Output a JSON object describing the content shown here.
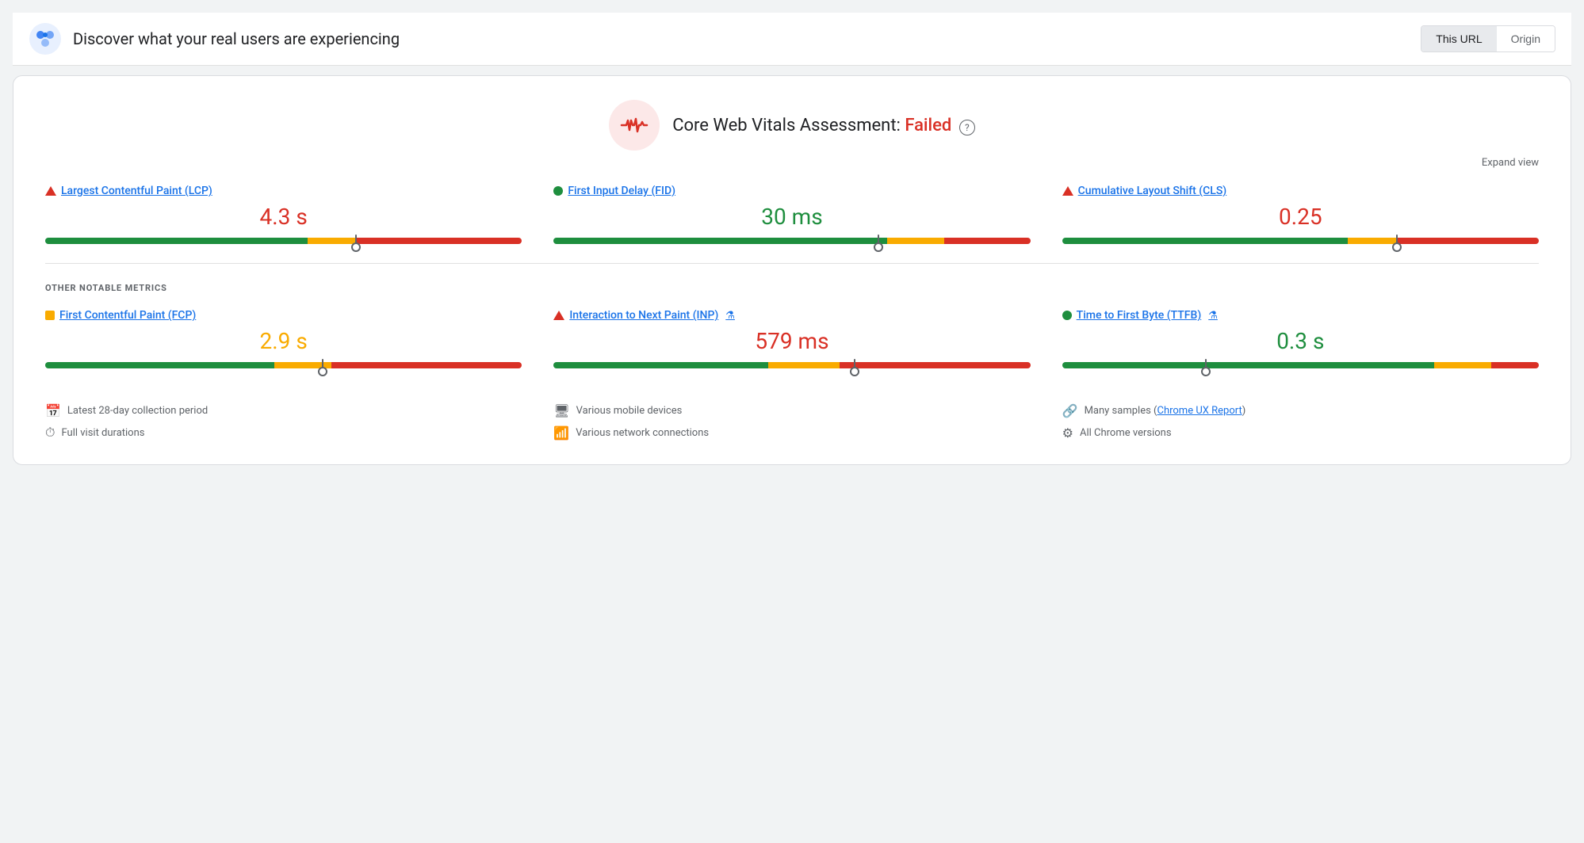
{
  "header": {
    "title": "Discover what your real users are experiencing",
    "this_url_label": "This URL",
    "origin_label": "Origin",
    "active_tab": "this_url"
  },
  "assessment": {
    "title_prefix": "Core Web Vitals Assessment: ",
    "status": "Failed",
    "expand_label": "Expand view",
    "info_label": "?"
  },
  "core_vitals": {
    "section_label": "",
    "metrics": [
      {
        "id": "lcp",
        "label": "Largest Contentful Paint (LCP)",
        "status": "red_triangle",
        "value": "4.3 s",
        "value_color": "red",
        "bar": {
          "green": 55,
          "orange": 10,
          "red": 35,
          "marker": 65
        }
      },
      {
        "id": "fid",
        "label": "First Input Delay (FID)",
        "status": "green_dot",
        "value": "30 ms",
        "value_color": "green",
        "bar": {
          "green": 70,
          "orange": 12,
          "red": 18,
          "marker": 68
        }
      },
      {
        "id": "cls",
        "label": "Cumulative Layout Shift (CLS)",
        "status": "red_triangle",
        "value": "0.25",
        "value_color": "red",
        "bar": {
          "green": 60,
          "orange": 10,
          "red": 30,
          "marker": 70
        }
      }
    ]
  },
  "other_metrics": {
    "section_label": "OTHER NOTABLE METRICS",
    "metrics": [
      {
        "id": "fcp",
        "label": "First Contentful Paint (FCP)",
        "status": "orange_square",
        "value": "2.9 s",
        "value_color": "orange",
        "has_flask": false,
        "bar": {
          "green": 48,
          "orange": 12,
          "red": 40,
          "marker": 58
        }
      },
      {
        "id": "inp",
        "label": "Interaction to Next Paint (INP)",
        "status": "red_triangle",
        "value": "579 ms",
        "value_color": "red",
        "has_flask": true,
        "bar": {
          "green": 45,
          "orange": 15,
          "red": 40,
          "marker": 63
        }
      },
      {
        "id": "ttfb",
        "label": "Time to First Byte (TTFB)",
        "status": "green_dot",
        "value": "0.3 s",
        "value_color": "green",
        "has_flask": true,
        "bar": {
          "green": 78,
          "orange": 12,
          "red": 10,
          "marker": 30
        }
      }
    ]
  },
  "footer": {
    "items": [
      {
        "id": "collection",
        "icon": "📅",
        "text": "Latest 28-day collection period"
      },
      {
        "id": "devices",
        "icon": "🖥",
        "text": "Various mobile devices"
      },
      {
        "id": "samples",
        "icon": "🔗",
        "text": "Many samples",
        "link": "Chrome UX Report"
      },
      {
        "id": "visit",
        "icon": "⏱",
        "text": "Full visit durations"
      },
      {
        "id": "network",
        "icon": "📶",
        "text": "Various network connections"
      },
      {
        "id": "chrome",
        "icon": "⚙",
        "text": "All Chrome versions"
      }
    ]
  }
}
